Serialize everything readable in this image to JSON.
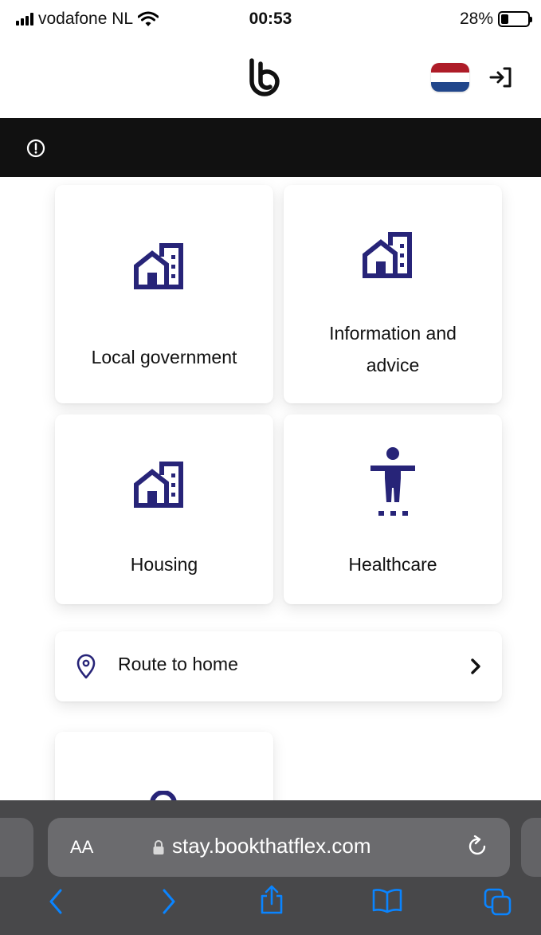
{
  "status_bar": {
    "carrier": "vodafone NL",
    "time": "00:53",
    "battery": "28%",
    "battery_level": 0.28
  },
  "header": {
    "logo_icon": "bookthatflex-logo-icon",
    "language_flag": "netherlands-flag-icon",
    "login_icon": "login-icon"
  },
  "alert": {
    "icon": "alert-circle-icon"
  },
  "cards": [
    {
      "label": "Local government",
      "icon": "buildings-icon"
    },
    {
      "label": "Information and advice",
      "icon": "buildings-icon"
    },
    {
      "label": "Housing",
      "icon": "buildings-icon"
    },
    {
      "label": "Healthcare",
      "icon": "accessibility-person-icon"
    },
    {
      "label": "",
      "icon": "lock-icon"
    }
  ],
  "route": {
    "label": "Route to home",
    "icon": "location-pin-icon"
  },
  "browser": {
    "text_size_button": "AA",
    "url": "stay.bookthatflex.com"
  },
  "colors": {
    "accent": "#272478",
    "alert_bar": "#111111",
    "flag_red": "#ae1c28",
    "flag_white": "#ffffff",
    "flag_blue": "#21468b",
    "browser_blue": "#0a84ff"
  }
}
